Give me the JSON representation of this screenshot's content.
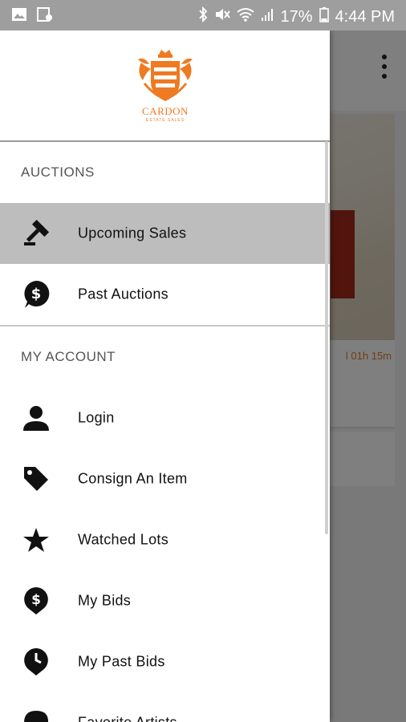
{
  "status_bar": {
    "battery": "17%",
    "time": "4:44 PM"
  },
  "logo": {
    "name": "CARDON",
    "tagline": "ESTATE SALES",
    "color": "#ee7a22"
  },
  "background": {
    "countdown_fragment": "l 01h 15m",
    "accent": "#e07a2a"
  },
  "sections": {
    "auctions": "AUCTIONS",
    "my_account": "MY ACCOUNT"
  },
  "items": {
    "upcoming_sales": {
      "label": "Upcoming Sales",
      "icon": "gavel-icon"
    },
    "past_auctions": {
      "label": "Past Auctions",
      "icon": "dollar-pin-icon"
    },
    "login": {
      "label": "Login",
      "icon": "person-icon"
    },
    "consign": {
      "label": "Consign An Item",
      "icon": "tag-icon"
    },
    "watched": {
      "label": "Watched Lots",
      "icon": "star-icon"
    },
    "my_bids": {
      "label": "My Bids",
      "icon": "dollar-pin-icon"
    },
    "past_bids": {
      "label": "My Past Bids",
      "icon": "clock-pin-icon"
    },
    "favorite_artists": {
      "label": "Favorite Artists",
      "icon": "palette-icon"
    }
  }
}
